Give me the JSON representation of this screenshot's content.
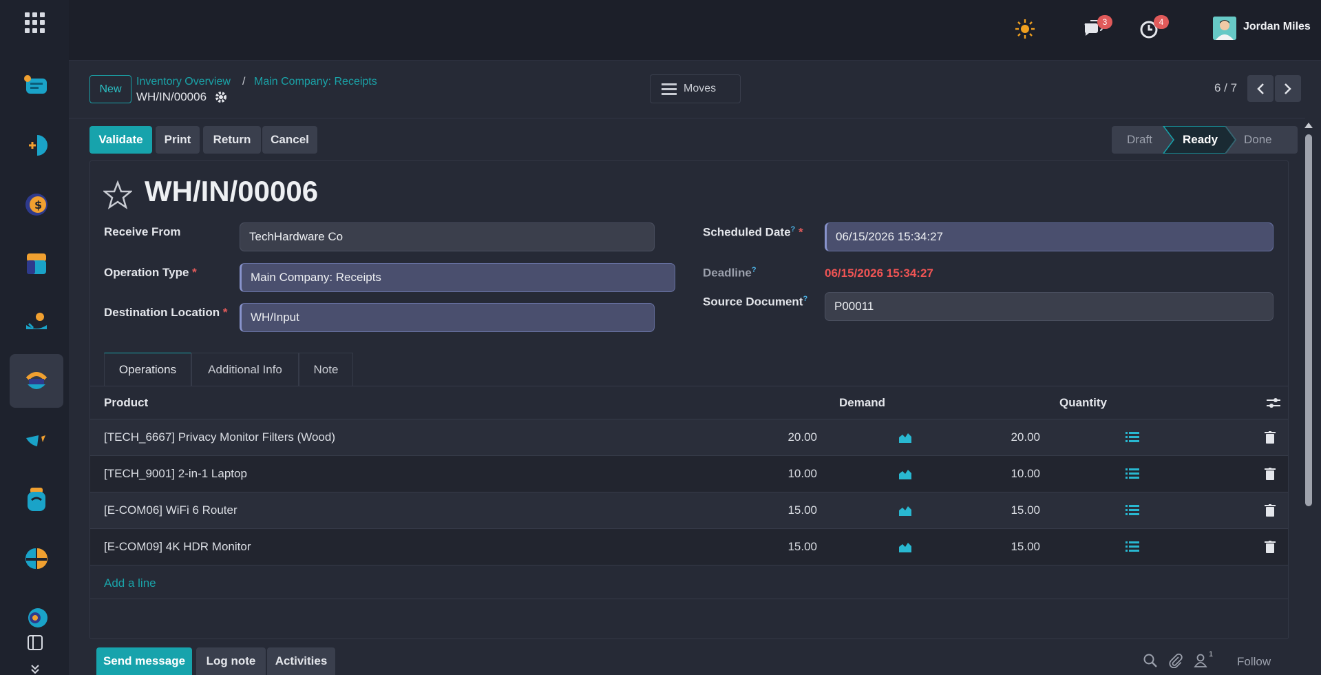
{
  "topbar": {
    "theme_icon": "sun-icon",
    "messages_badge": "3",
    "activities_badge": "4",
    "user_name": "Jordan Miles"
  },
  "control": {
    "new_label": "New",
    "breadcrumb": [
      "Inventory Overview",
      "Main Company: Receipts"
    ],
    "breadcrumb_sep": "/",
    "current_record": "WH/IN/00006",
    "moves_label": "Moves",
    "pager": "6 / 7"
  },
  "actions": {
    "validate": "Validate",
    "print": "Print",
    "return": "Return",
    "cancel": "Cancel"
  },
  "status": {
    "stages": [
      "Draft",
      "Ready",
      "Done"
    ],
    "current": "Ready"
  },
  "form": {
    "title": "WH/IN/00006",
    "receive_from_label": "Receive From",
    "receive_from": "TechHardware Co",
    "operation_type_label": "Operation Type",
    "operation_type": "Main Company: Receipts",
    "destination_label": "Destination Location",
    "destination": "WH/Input",
    "scheduled_label": "Scheduled Date",
    "scheduled": "06/15/2026 15:34:27",
    "deadline_label": "Deadline",
    "deadline": "06/15/2026 15:34:27",
    "source_label": "Source Document",
    "source": "P00011",
    "required_mark": "*",
    "help_mark": "?"
  },
  "tabs": [
    "Operations",
    "Additional Info",
    "Note"
  ],
  "table": {
    "columns": [
      "Product",
      "Demand",
      "Quantity"
    ],
    "rows": [
      {
        "product": "[TECH_6667] Privacy Monitor Filters (Wood)",
        "demand": "20.00",
        "quantity": "20.00"
      },
      {
        "product": "[TECH_9001] 2-in-1 Laptop",
        "demand": "10.00",
        "quantity": "10.00"
      },
      {
        "product": "[E-COM06] WiFi 6 Router",
        "demand": "15.00",
        "quantity": "15.00"
      },
      {
        "product": "[E-COM09] 4K HDR Monitor",
        "demand": "15.00",
        "quantity": "15.00"
      }
    ],
    "add_line": "Add a line"
  },
  "chatter": {
    "send_message": "Send message",
    "log_note": "Log note",
    "activities": "Activities",
    "followers_count": "1",
    "follow": "Follow"
  },
  "colors": {
    "accent": "#17a3ac",
    "deadline_red": "#f05454",
    "background": "#262a36"
  }
}
